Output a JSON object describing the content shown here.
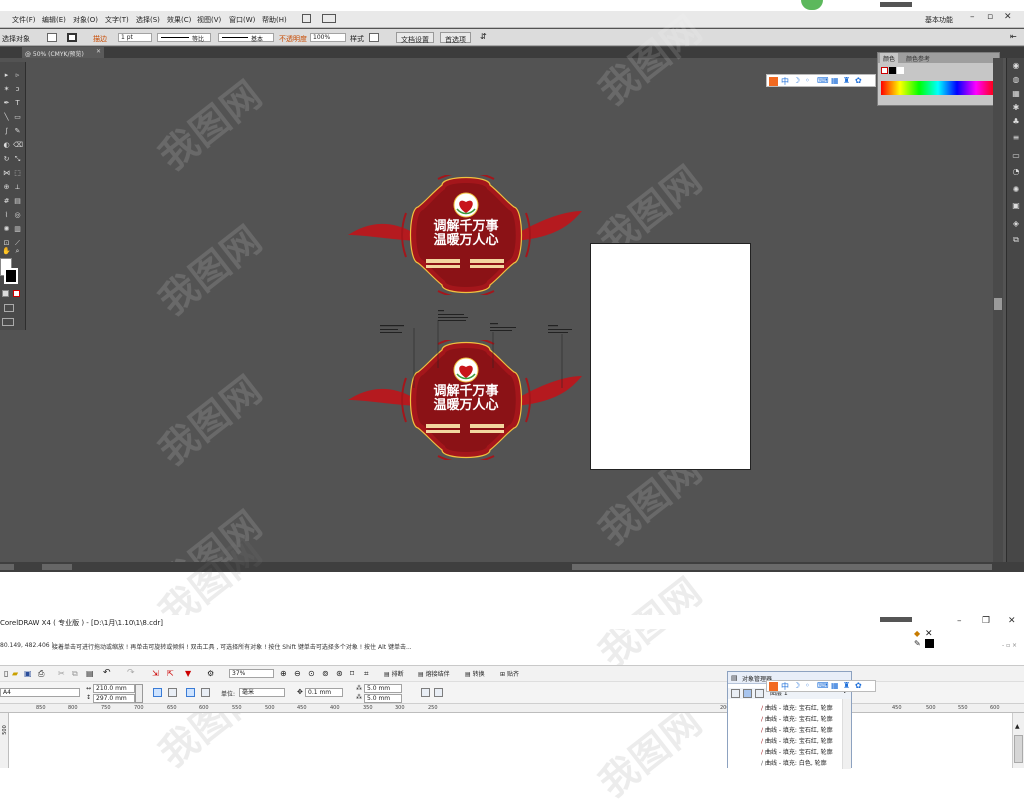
{
  "illustrator": {
    "menu": [
      "文件(F)",
      "编辑(E)",
      "对象(O)",
      "文字(T)",
      "选择(S)",
      "效果(C)",
      "视图(V)",
      "窗口(W)",
      "帮助(H)"
    ],
    "workspace_label": "基本功能",
    "ctrl": {
      "selection_label": "选择对象",
      "stroke_label": "描边",
      "stroke_weight": "1 pt",
      "profile_label": "等比",
      "brush_label": "基本",
      "opacity_label": "不透明度",
      "opacity_value": "100%",
      "style_label": "样式",
      "doc_setup_button": "文档设置",
      "preferences_button": "首选项"
    },
    "doc_tab": "@ 50% (CMYK/预览)",
    "color_panel": {
      "tab_color": "颜色",
      "tab_guide": "颜色参考"
    },
    "badge": {
      "line1": "调解千万事",
      "line2": "温暖万人心"
    },
    "colors": {
      "badge_red": "#a4161b",
      "badge_dark": "#8b1216",
      "badge_gold": "#f0c040",
      "ribbon": "#b51a1f"
    },
    "watermark": "我图网"
  },
  "coreldraw": {
    "title": "CorelDRAW X4 ( 专业版 ) - [D:\\1月\\1.10\\1\\8.cdr]",
    "hint_coords": "80.149, 482.406 )",
    "hint_text": "接着单击可进行拖动或缩放 ! 再单击可旋转或倾斜 ! 双击工具 , 可选择所有对象 ! 按住 Shift 键单击可选择多个对象 ! 按住 Alt 键单击...",
    "zoom": "37%",
    "tb_labels": {
      "arrange": "排断",
      "weld": "熔接结伴",
      "convert": "转换",
      "paste": "贴齐"
    },
    "page_size_label": "A4",
    "width": "210.0 mm",
    "height": "297.0 mm",
    "unit_label": "单位:",
    "unit_value": "毫米",
    "nudge": "0.1 mm",
    "dup_x": "5.0 mm",
    "dup_y": "5.0 mm",
    "ruler_left": [
      "850",
      "800",
      "750",
      "700",
      "650",
      "600",
      "550",
      "500",
      "450",
      "400",
      "350",
      "300",
      "250",
      "200"
    ],
    "ruler_right": [
      "450",
      "500",
      "550",
      "600"
    ],
    "vruler": "500",
    "object_manager": {
      "title": "对象管理器",
      "layer_label": "图层 1",
      "rows": [
        "曲线 - 填充: 宝石红, 轮廓",
        "曲线 - 填充: 宝石红, 轮廓",
        "曲线 - 填充: 宝石红, 轮廓",
        "曲线 - 填充: 宝石红, 轮廓",
        "曲线 - 填充: 宝石红, 轮廓",
        "曲线 - 填充: 白色, 轮廓"
      ]
    }
  }
}
